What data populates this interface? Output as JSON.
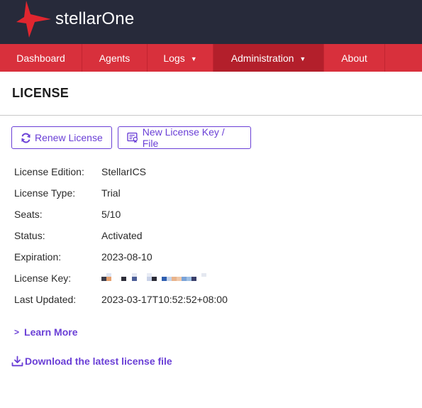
{
  "app": {
    "brand": "stellarOne",
    "logo_icon": "star-logo-icon",
    "brand_color": "#d8303c",
    "header_bg": "#272a3a",
    "accent": "#6a3fd6"
  },
  "nav": {
    "items": [
      {
        "label": "Dashboard",
        "dropdown": false
      },
      {
        "label": "Agents",
        "dropdown": false
      },
      {
        "label": "Logs",
        "dropdown": true
      },
      {
        "label": "Administration",
        "dropdown": true,
        "active": true
      },
      {
        "label": "About",
        "dropdown": false
      }
    ]
  },
  "page": {
    "title": "LICENSE"
  },
  "actions": {
    "renew_label": "Renew License",
    "renew_icon": "refresh-icon",
    "new_key_label": "New License Key / File",
    "new_key_icon": "license-certificate-icon"
  },
  "license": {
    "edition_label": "License Edition:",
    "edition_value": "StellarICS",
    "type_label": "License Type:",
    "type_value": "Trial",
    "seats_label": "Seats:",
    "seats_value": "5/10",
    "status_label": "Status:",
    "status_value": "Activated",
    "expiration_label": "Expiration:",
    "expiration_value": "2023-08-10",
    "key_label": "License Key:",
    "key_value_note": "pixelated-redacted",
    "updated_label": "Last Updated:",
    "updated_value": "2023-03-17T10:52:52+08:00"
  },
  "links": {
    "learn_more": "Learn More",
    "learn_more_icon": "chevron-right-icon",
    "download": "Download the latest license file",
    "download_icon": "download-icon"
  }
}
